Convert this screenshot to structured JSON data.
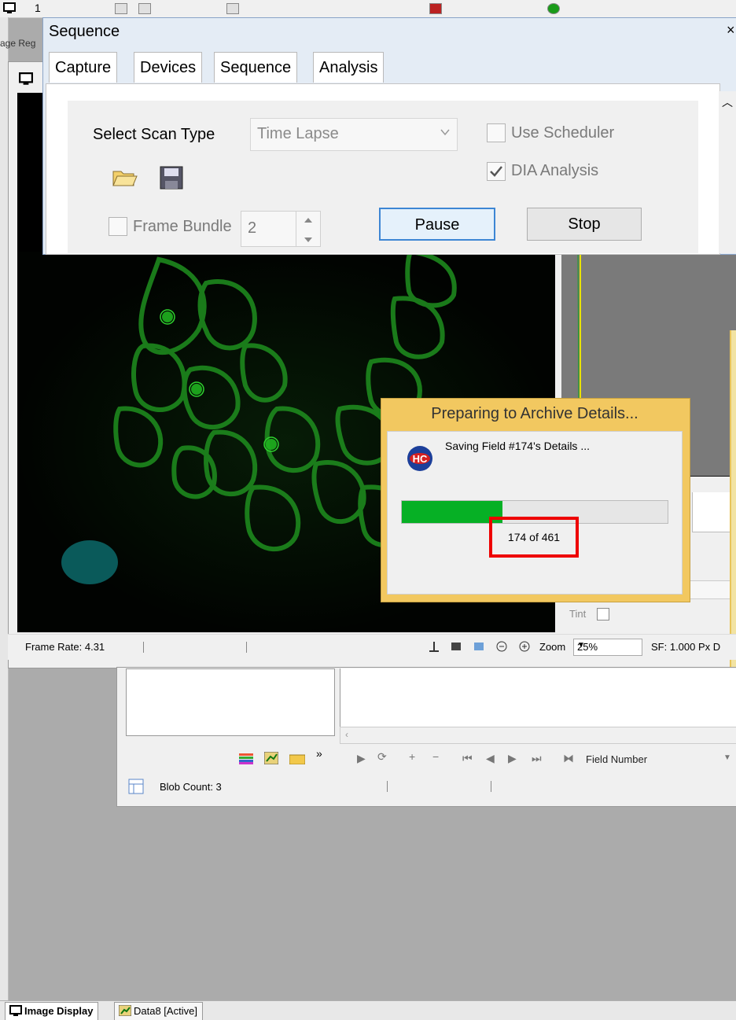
{
  "top_toolbar": {
    "fragment": "1"
  },
  "left_strip": {
    "label": "age Reg"
  },
  "sequence_dialog": {
    "title": "Sequence",
    "close_glyph": "×",
    "tabs": [
      {
        "label": "Capture"
      },
      {
        "label": "Devices"
      },
      {
        "label": "Sequence"
      },
      {
        "label": "Analysis"
      }
    ],
    "scan_type_label": "Select Scan Type",
    "scan_type_value": "Time Lapse",
    "use_scheduler_label": "Use Scheduler",
    "use_scheduler_checked": false,
    "dia_analysis_label": "DIA Analysis",
    "dia_analysis_checked": true,
    "frame_bundle_label": "Frame Bundle",
    "frame_bundle_checked": false,
    "frame_bundle_value": "2",
    "pause_label": "Pause",
    "stop_label": "Stop",
    "icons": [
      "open-folder-icon",
      "save-icon"
    ]
  },
  "archive_dialog": {
    "title": "Preparing to Archive Details...",
    "message": "Saving Field #174's Details ...",
    "logo_text": "HC",
    "progress_current": 174,
    "progress_total": 461,
    "progress_text": "174 of 461",
    "colors": {
      "header": "#f2c860",
      "progress": "#06b025",
      "highlight": "#ee0000"
    }
  },
  "image_panel": {
    "tint_label": "Tint",
    "overlay_colors": {
      "cell_membrane": "#1fb21f",
      "blob": "#0a5a5a"
    }
  },
  "status_bar": {
    "frame_rate": "Frame Rate: 4.31",
    "zoom_label": "Zoom",
    "zoom_value": "25%",
    "sf_text": "SF: 1.000 Px",
    "sf_fragment": "D"
  },
  "data_window": {
    "field_label": "Field Number",
    "blob_count": "Blob Count: 3",
    "overflow_glyph": "»"
  },
  "bottom_tabs": [
    {
      "label": "Image Display",
      "active": true
    },
    {
      "label": "Data8 [Active]",
      "active": false
    }
  ]
}
